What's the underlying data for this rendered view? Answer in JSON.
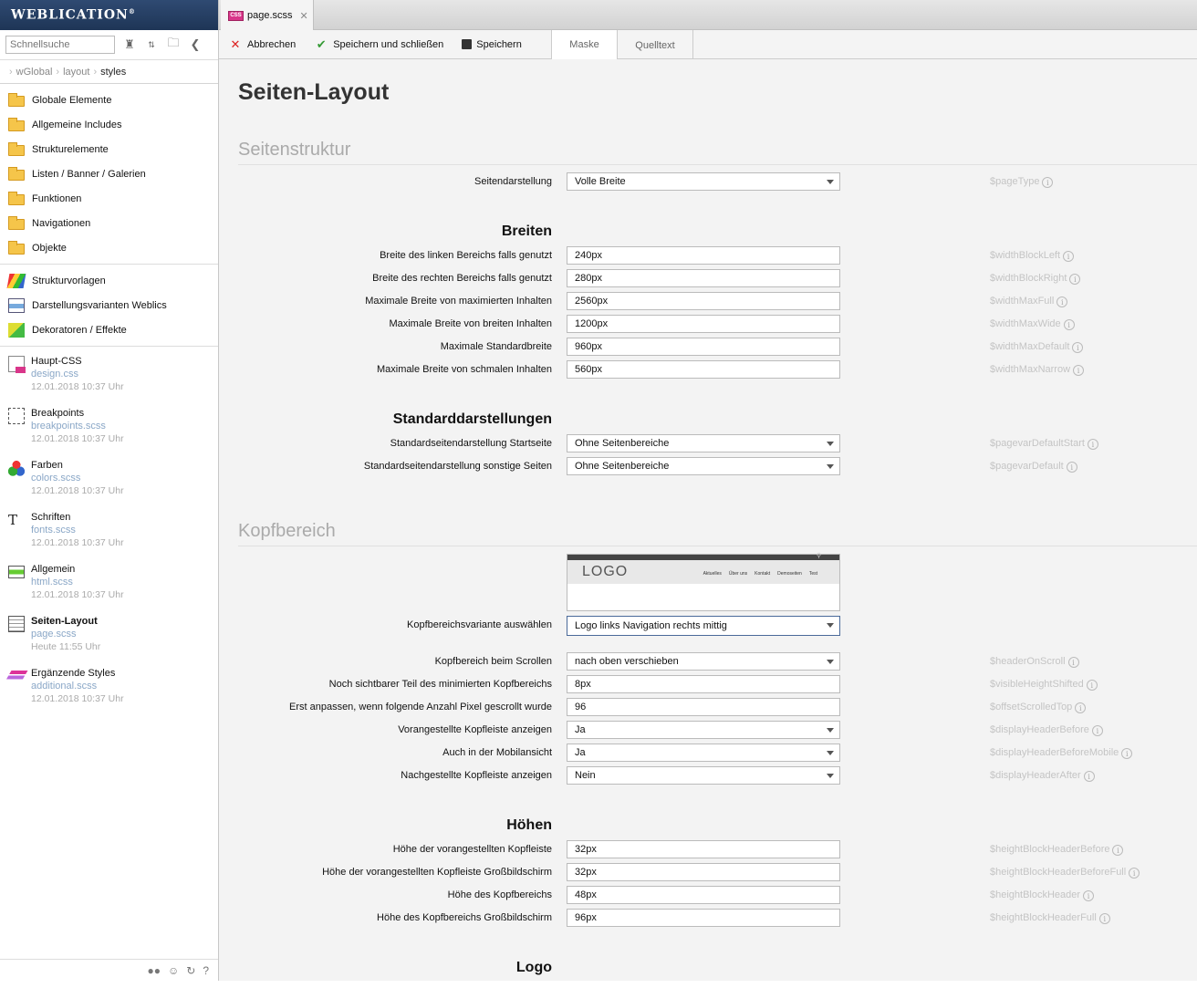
{
  "brand": {
    "name": "Weblication",
    "mark": "®"
  },
  "sidebar": {
    "search_placeholder": "Schnellsuche",
    "breadcrumb": [
      "wGlobal",
      "layout",
      "styles"
    ],
    "folders": [
      "Globale Elemente",
      "Allgemeine Includes",
      "Strukturelemente",
      "Listen / Banner / Galerien",
      "Funktionen",
      "Navigationen",
      "Objekte"
    ],
    "tools": [
      "Strukturvorlagen",
      "Darstellungsvarianten Weblics",
      "Dekoratoren / Effekte"
    ],
    "files": [
      {
        "name": "Haupt-CSS",
        "file": "design.css",
        "date": "12.01.2018 10:37 Uhr"
      },
      {
        "name": "Breakpoints",
        "file": "breakpoints.scss",
        "date": "12.01.2018 10:37 Uhr"
      },
      {
        "name": "Farben",
        "file": "colors.scss",
        "date": "12.01.2018 10:37 Uhr"
      },
      {
        "name": "Schriften",
        "file": "fonts.scss",
        "date": "12.01.2018 10:37 Uhr"
      },
      {
        "name": "Allgemein",
        "file": "html.scss",
        "date": "12.01.2018 10:37 Uhr"
      },
      {
        "name": "Seiten-Layout",
        "file": "page.scss",
        "date": "Heute 11:55 Uhr"
      },
      {
        "name": "Ergänzende Styles",
        "file": "additional.scss",
        "date": "12.01.2018 10:37 Uhr"
      }
    ]
  },
  "tab": {
    "label": "page.scss",
    "icon_text": "CSS"
  },
  "toolbar": {
    "cancel": "Abbrechen",
    "save_close": "Speichern und schließen",
    "save": "Speichern"
  },
  "view_tabs": [
    "Maske",
    "Quelltext"
  ],
  "page": {
    "title": "Seiten-Layout",
    "section1": "Seitenstruktur",
    "section2": "Kopfbereich",
    "sub_breiten": "Breiten",
    "sub_standard": "Standarddarstellungen",
    "sub_hoehen": "Höhen",
    "sub_logo": "Logo",
    "rows": [
      {
        "label": "Seitendarstellung",
        "value": "Volle Breite",
        "var": "$pageType"
      },
      {
        "label": "Breite des linken Bereichs falls genutzt",
        "value": "240px",
        "var": "$widthBlockLeft"
      },
      {
        "label": "Breite des rechten Bereichs falls genutzt",
        "value": "280px",
        "var": "$widthBlockRight"
      },
      {
        "label": "Maximale Breite von maximierten Inhalten",
        "value": "2560px",
        "var": "$widthMaxFull"
      },
      {
        "label": "Maximale Breite von breiten Inhalten",
        "value": "1200px",
        "var": "$widthMaxWide"
      },
      {
        "label": "Maximale Standardbreite",
        "value": "960px",
        "var": "$widthMaxDefault"
      },
      {
        "label": "Maximale Breite von schmalen Inhalten",
        "value": "560px",
        "var": "$widthMaxNarrow"
      },
      {
        "label": "Standardseitendarstellung Startseite",
        "value": "Ohne Seitenbereiche",
        "var": "$pagevarDefaultStart"
      },
      {
        "label": "Standardseitendarstellung sonstige Seiten",
        "value": "Ohne Seitenbereiche",
        "var": "$pagevarDefault"
      },
      {
        "label": "Kopfbereichsvariante auswählen",
        "value": "Logo links Navigation rechts mittig",
        "var": ""
      },
      {
        "label": "Kopfbereich beim Scrollen",
        "value": "nach oben verschieben",
        "var": "$headerOnScroll"
      },
      {
        "label": "Noch sichtbarer Teil des minimierten Kopfbereichs",
        "value": "8px",
        "var": "$visibleHeightShifted"
      },
      {
        "label": "Erst anpassen, wenn folgende Anzahl Pixel gescrollt wurde",
        "value": "96",
        "var": "$offsetScrolledTop"
      },
      {
        "label": "Vorangestellte Kopfleiste anzeigen",
        "value": "Ja",
        "var": "$displayHeaderBefore"
      },
      {
        "label": "Auch in der Mobilansicht",
        "value": "Ja",
        "var": "$displayHeaderBeforeMobile"
      },
      {
        "label": "Nachgestellte Kopfleiste anzeigen",
        "value": "Nein",
        "var": "$displayHeaderAfter"
      },
      {
        "label": "Höhe der vorangestellten Kopfleiste",
        "value": "32px",
        "var": "$heightBlockHeaderBefore"
      },
      {
        "label": "Höhe der vorangestellten Kopfleiste Großbildschirm",
        "value": "32px",
        "var": "$heightBlockHeaderBeforeFull"
      },
      {
        "label": "Höhe des Kopfbereichs",
        "value": "48px",
        "var": "$heightBlockHeader"
      },
      {
        "label": "Höhe des Kopfbereichs Großbildschirm",
        "value": "96px",
        "var": "$heightBlockHeaderFull"
      }
    ],
    "preview": {
      "logo": "LOGO",
      "nav": [
        "Aktuelles",
        "Über uns",
        "Kontakt",
        "Demoseiten",
        "Test"
      ]
    }
  },
  "colors": {
    "brand_bg": "#1e3556",
    "css_icon": "#d9368a",
    "folder": "#f5c54a",
    "file_link": "#8aa7c7"
  }
}
